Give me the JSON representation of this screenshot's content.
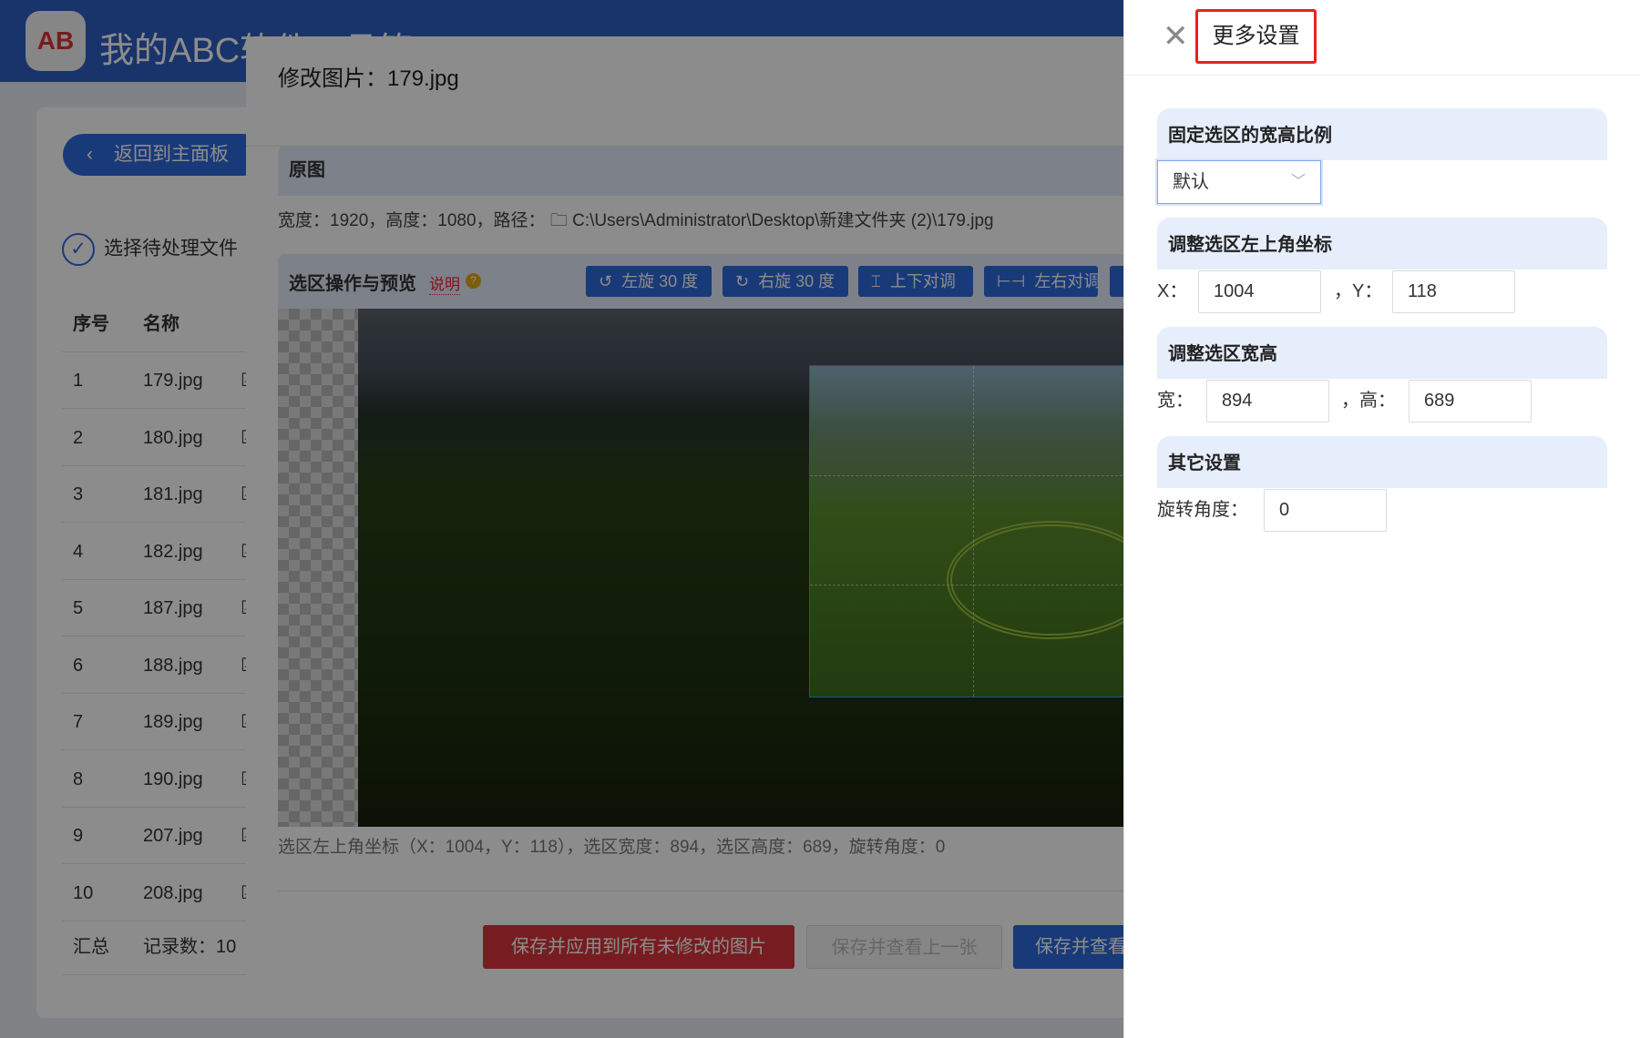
{
  "app": {
    "title": "我的ABC软件工具箱",
    "logo": "AB"
  },
  "left": {
    "back": "返回到主面板",
    "step": "选择待处理文件",
    "table": {
      "headers": [
        "序号",
        "名称"
      ],
      "rows": [
        [
          "1",
          "179.jpg"
        ],
        [
          "2",
          "180.jpg"
        ],
        [
          "3",
          "181.jpg"
        ],
        [
          "4",
          "182.jpg"
        ],
        [
          "5",
          "187.jpg"
        ],
        [
          "6",
          "188.jpg"
        ],
        [
          "7",
          "189.jpg"
        ],
        [
          "8",
          "190.jpg"
        ],
        [
          "9",
          "207.jpg"
        ],
        [
          "10",
          "208.jpg"
        ]
      ],
      "summary": [
        "汇总",
        "记录数：10"
      ]
    }
  },
  "modal": {
    "title": "修改图片：179.jpg",
    "original_label": "原图",
    "info": "宽度：1920，高度：1080，路径：",
    "path": "C:\\Users\\Administrator\\Desktop\\新建文件夹 (2)\\179.jpg",
    "preview_label": "选区操作与预览",
    "help": "说明",
    "tools": [
      {
        "label": "左旋 30 度",
        "icon": "rotate-left-icon"
      },
      {
        "label": "右旋 30 度",
        "icon": "rotate-right-icon"
      },
      {
        "label": "上下对调",
        "icon": "flip-vertical-icon"
      },
      {
        "label": "左右对调",
        "icon": "flip-horizontal-icon"
      }
    ],
    "status": "选区左上角坐标（X：1004，Y：118），选区宽度：894，选区高度：689，旋转角度：0",
    "buttons": {
      "apply_all": "保存并应用到所有未修改的图片",
      "prev": "保存并查看上一张",
      "next": "保存并查看下一张"
    }
  },
  "drawer": {
    "title": "更多设置",
    "ratio": {
      "label": "固定选区的宽高比例",
      "value": "默认"
    },
    "coords": {
      "label": "调整选区左上角坐标",
      "x_label": "X：",
      "x": "1004",
      "sep": "，",
      "y_label": "Y：",
      "y": "118"
    },
    "size": {
      "label": "调整选区宽高",
      "w_label": "宽：",
      "w": "894",
      "sep": "，",
      "h_label": "高：",
      "h": "689"
    },
    "other": {
      "label": "其它设置",
      "rot_label": "旋转角度：",
      "rot": "0"
    }
  },
  "colors": {
    "primary": "#2f6bdc",
    "danger": "#d9363e",
    "highlight": "#e8231b"
  }
}
